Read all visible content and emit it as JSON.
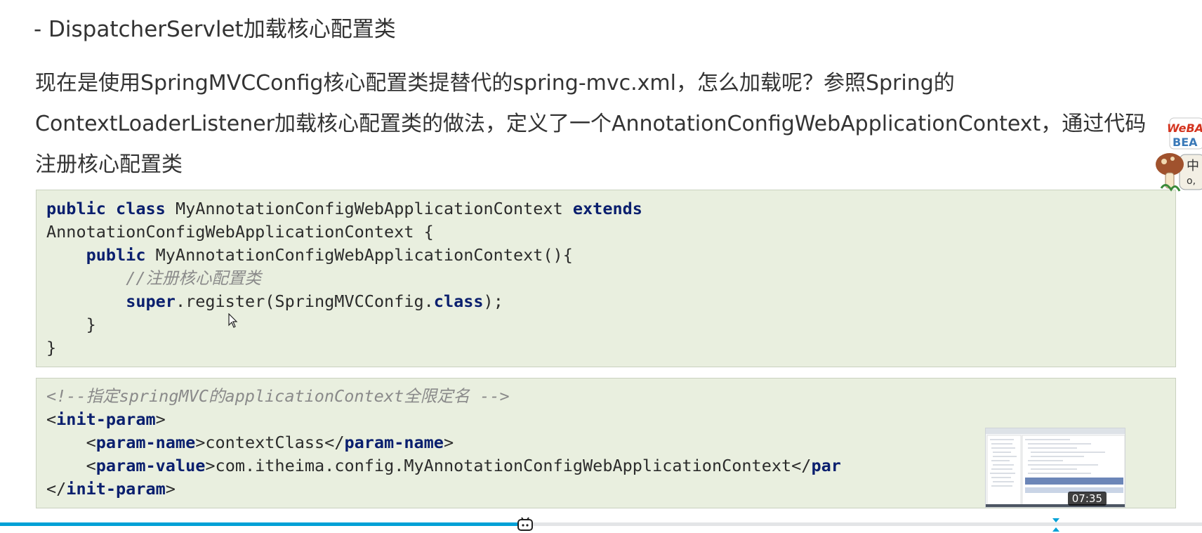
{
  "heading": "- DispatcherServlet加载核心配置类",
  "paragraph": "现在是使用SpringMVCConfig核心配置类提替代的spring-mvc.xml，怎么加载呢？参照Spring的ContextLoaderListener加载核心配置类的做法，定义了一个AnnotationConfigWebApplicationContext，通过代码注册核心配置类",
  "code_java": {
    "line1": {
      "kw1": "public",
      "kw2": "class",
      "name": " MyAnnotationConfigWebApplicationContext ",
      "kw3": "extends"
    },
    "line2": "AnnotationConfigWebApplicationContext {",
    "line3": {
      "indent": "    ",
      "kw": "public",
      "rest": " MyAnnotationConfigWebApplicationContext(){"
    },
    "line4": {
      "indent": "        ",
      "comment": "//注册核心配置类"
    },
    "line5": {
      "indent": "        ",
      "kw": "super",
      "mid": ".register(SpringMVCConfig.",
      "kw2": "class",
      "end": ");"
    },
    "line6": "    }",
    "line7": "}"
  },
  "code_xml": {
    "comment": "<!--指定springMVC的applicationContext全限定名 -->",
    "open_tag": "init-param",
    "param_name_tag": "param-name",
    "param_name_value": "contextClass",
    "param_value_tag": "param-value",
    "param_value_value": "com.itheima.config.MyAnnotationConfigWebApplicationContext",
    "param_value_close_partial": "par",
    "close_tag": "init-param"
  },
  "video": {
    "thumbnail_time": "07:35",
    "progress": 0.437,
    "accent_color": "#00a1d6"
  },
  "overlay": {
    "badge_text_1": "WeBA",
    "badge_text_2": "BEA",
    "badge_text_3": "中",
    "badge_text_4": "o,"
  }
}
